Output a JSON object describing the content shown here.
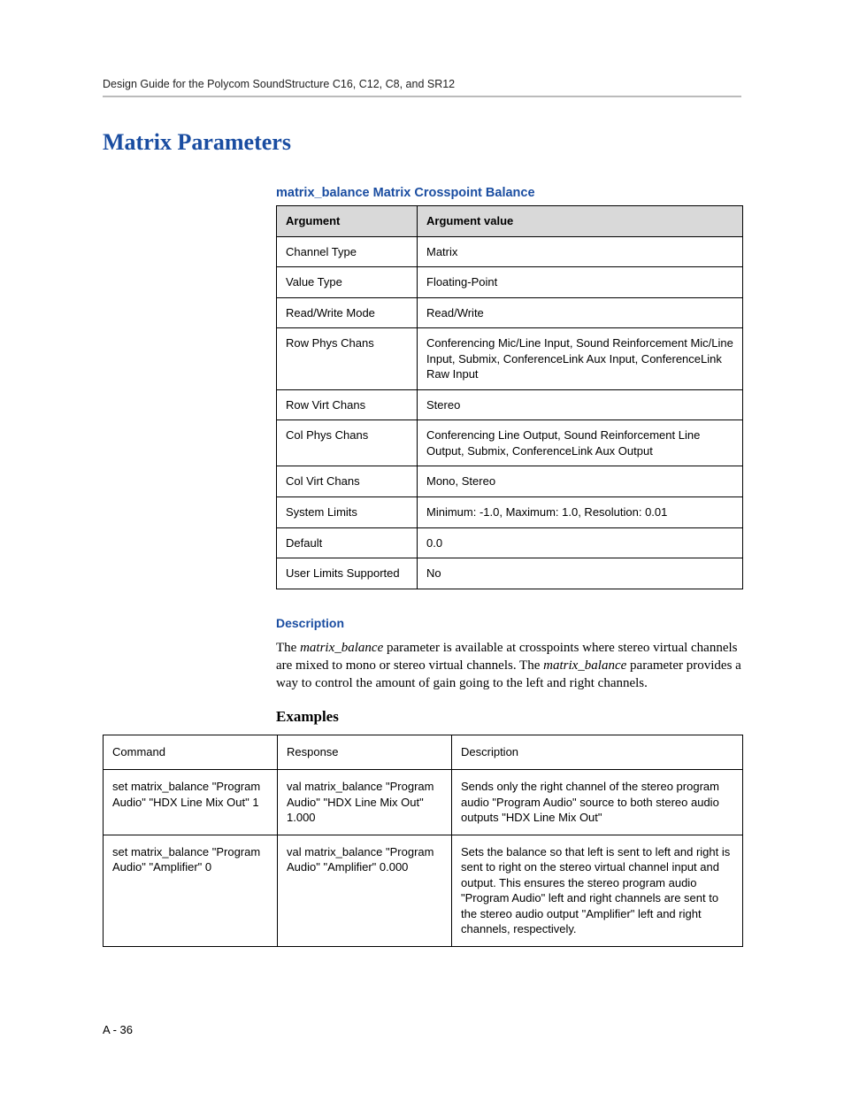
{
  "header": {
    "running": "Design Guide for the Polycom SoundStructure C16, C12, C8, and SR12"
  },
  "section": {
    "title": "Matrix Parameters"
  },
  "param": {
    "title": "matrix_balance Matrix Crosspoint Balance",
    "col1": "Argument",
    "col2": "Argument value",
    "rows": [
      {
        "arg": "Channel Type",
        "val": "Matrix"
      },
      {
        "arg": "Value Type",
        "val": "Floating-Point"
      },
      {
        "arg": "Read/Write Mode",
        "val": "Read/Write"
      },
      {
        "arg": "Row Phys Chans",
        "val": "Conferencing Mic/Line Input, Sound Reinforcement Mic/Line Input, Submix, ConferenceLink Aux Input, ConferenceLink Raw Input"
      },
      {
        "arg": "Row Virt Chans",
        "val": "Stereo"
      },
      {
        "arg": "Col Phys Chans",
        "val": "Conferencing Line Output, Sound Reinforcement Line Output, Submix, ConferenceLink Aux Output"
      },
      {
        "arg": "Col Virt Chans",
        "val": "Mono, Stereo"
      },
      {
        "arg": "System Limits",
        "val": "Minimum: -1.0, Maximum: 1.0, Resolution: 0.01"
      },
      {
        "arg": "Default",
        "val": "0.0"
      },
      {
        "arg": "User Limits Supported",
        "val": "No"
      }
    ]
  },
  "description": {
    "heading": "Description",
    "pre": "The ",
    "term1": "matrix_balance",
    "mid": " parameter is available at crosspoints where stereo virtual channels are mixed to mono or stereo virtual channels. The ",
    "term2": "matrix_balance",
    "post": " parameter provides a way to control the amount of gain going to the left and right channels."
  },
  "examples": {
    "heading": "Examples",
    "cols": {
      "c1": "Command",
      "c2": "Response",
      "c3": "Description"
    },
    "rows": [
      {
        "cmd": "set matrix_balance \"Program Audio\" \"HDX Line Mix Out\" 1",
        "resp": "val matrix_balance \"Program Audio\" \"HDX Line Mix Out\" 1.000",
        "desc": "Sends only the right channel of the stereo program audio \"Program Audio\" source to both stereo audio outputs \"HDX Line Mix Out\""
      },
      {
        "cmd": "set matrix_balance \"Program Audio\" \"Amplifier\" 0",
        "resp": "val matrix_balance \"Program Audio\" \"Amplifier\" 0.000",
        "desc": "Sets the balance so that left is sent to left and right is sent to right on the stereo virtual channel input and output. This ensures the stereo program audio \"Program Audio\" left and right channels are sent to the stereo audio output \"Amplifier\" left and right channels, respectively."
      }
    ]
  },
  "footer": {
    "page": "A - 36"
  }
}
